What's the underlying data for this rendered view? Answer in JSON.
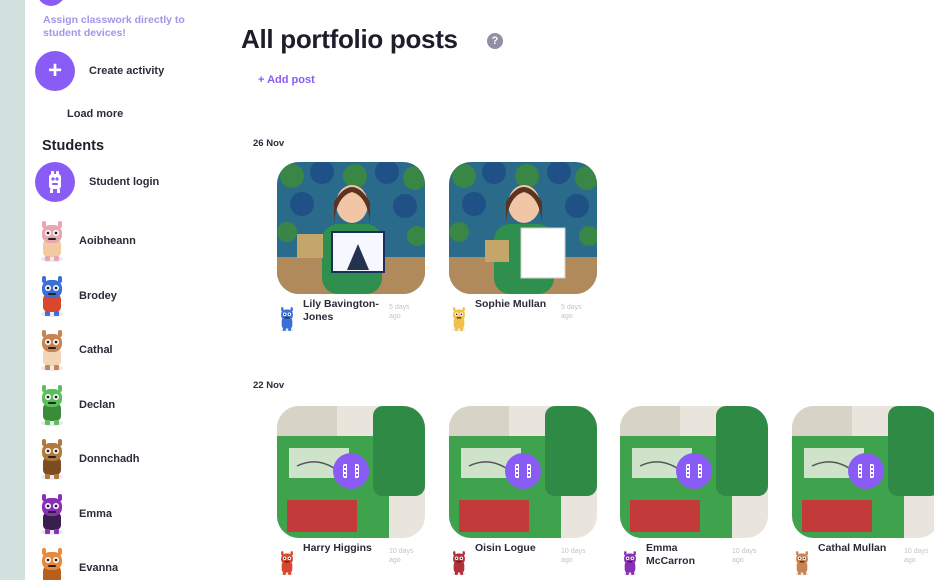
{
  "sidebar": {
    "promo_text": "Assign classwork directly to student devices!",
    "create_activity": "Create activity",
    "load_more": "Load more",
    "students_heading": "Students",
    "student_login": "Student login",
    "students": [
      {
        "name": "Aoibheann",
        "color": "#e7a6b0",
        "accent": "#f2c9a0"
      },
      {
        "name": "Brodey",
        "color": "#3a6fd8",
        "accent": "#d9472f"
      },
      {
        "name": "Cathal",
        "color": "#c98452",
        "accent": "#f0d6b5"
      },
      {
        "name": "Declan",
        "color": "#5cbf5c",
        "accent": "#3a8c3a"
      },
      {
        "name": "Donnchadh",
        "color": "#b07a3c",
        "accent": "#7a4e22"
      },
      {
        "name": "Emma",
        "color": "#8a2fb8",
        "accent": "#3a1f4d"
      },
      {
        "name": "Evanna",
        "color": "#e88a3a",
        "accent": "#b85f1c"
      }
    ]
  },
  "main": {
    "title": "All portfolio posts",
    "help_icon": "?",
    "add_post": "+ Add post",
    "groups": [
      {
        "date": "26 Nov",
        "posts": [
          {
            "author": "Lily Bavington-Jones",
            "time": "5 days ago",
            "avatar_color": "#3a6fd8",
            "kind": "photo"
          },
          {
            "author": "Sophie Mullan",
            "time": "5 days ago",
            "avatar_color": "#f2c04a",
            "kind": "photo"
          }
        ]
      },
      {
        "date": "22 Nov",
        "posts": [
          {
            "author": "Harry Higgins",
            "time": "10 days ago",
            "avatar_color": "#d9472f",
            "kind": "video"
          },
          {
            "author": "Oisin Logue",
            "time": "10 days ago",
            "avatar_color": "#b02f3a",
            "kind": "video"
          },
          {
            "author": "Emma McCarron",
            "time": "10 days ago",
            "avatar_color": "#8a2fb8",
            "kind": "video"
          },
          {
            "author": "Cathal Mullan",
            "time": "10 days ago",
            "avatar_color": "#c98452",
            "kind": "video"
          }
        ]
      }
    ]
  },
  "colors": {
    "accent": "#8a5cf6",
    "background": "#d2e1de"
  }
}
